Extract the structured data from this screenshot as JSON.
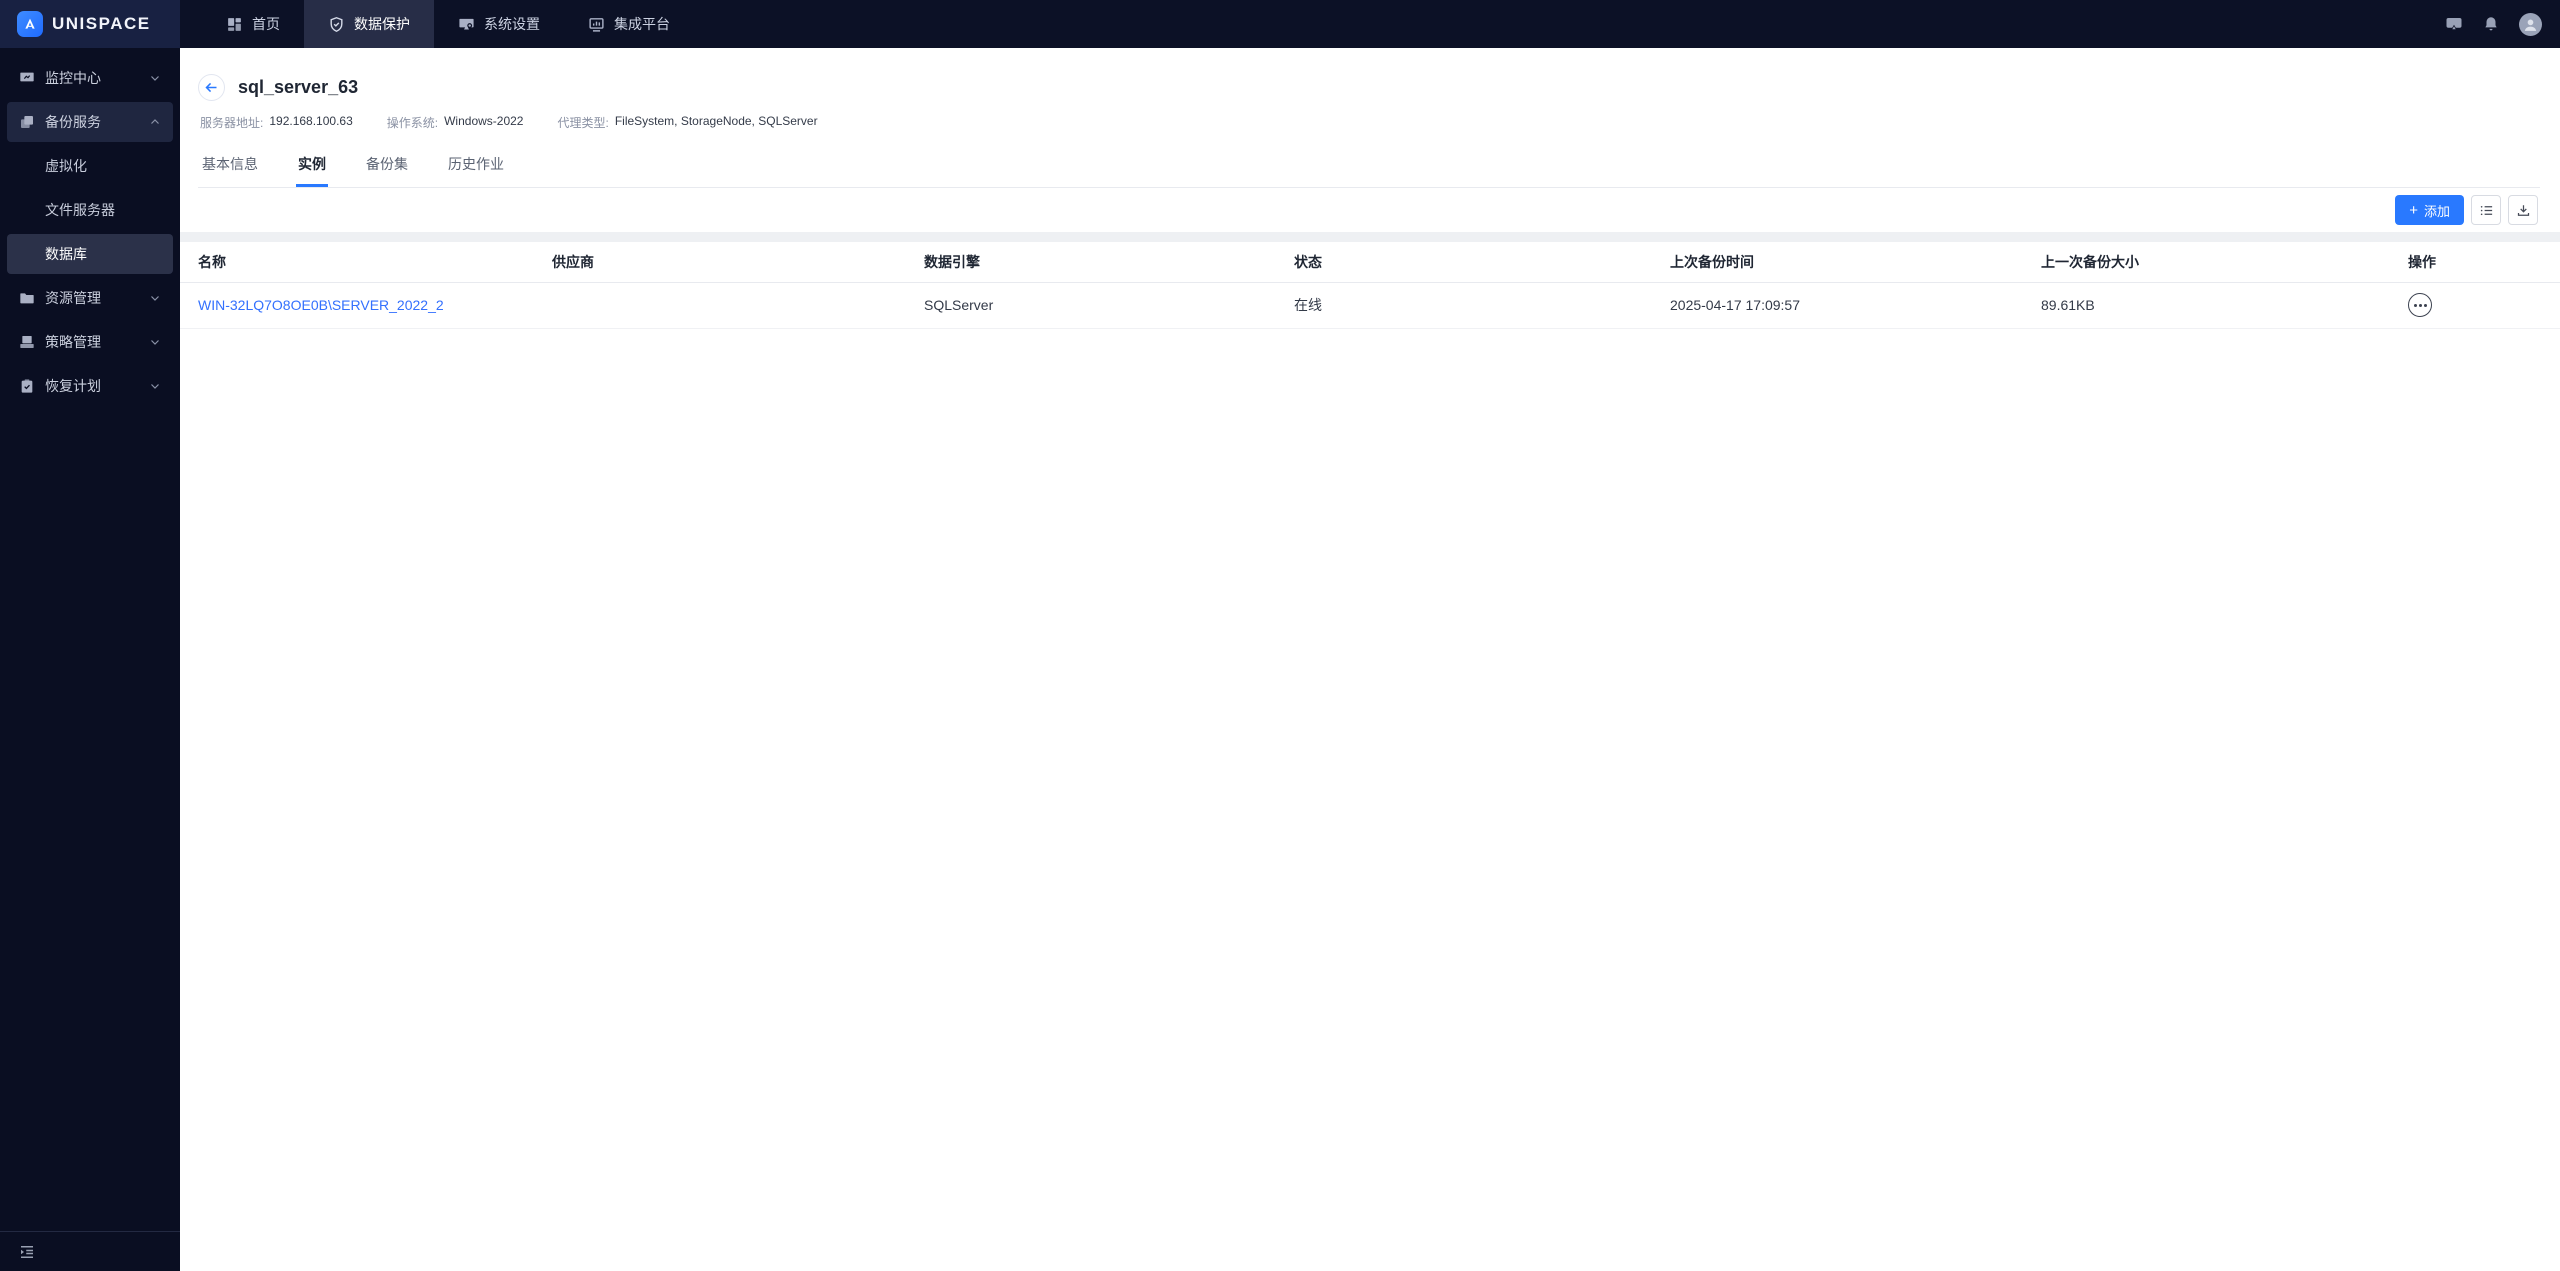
{
  "brand": {
    "name": "UNISPACE"
  },
  "topnav": {
    "items": [
      {
        "label": "首页"
      },
      {
        "label": "数据保护"
      },
      {
        "label": "系统设置"
      },
      {
        "label": "集成平台"
      }
    ]
  },
  "sidebar": {
    "items": [
      {
        "label": "监控中心",
        "state": "collapsed"
      },
      {
        "label": "备份服务",
        "state": "expanded"
      },
      {
        "label": "资源管理",
        "state": "collapsed"
      },
      {
        "label": "策略管理",
        "state": "collapsed"
      },
      {
        "label": "恢复计划",
        "state": "collapsed"
      }
    ],
    "backup_children": [
      {
        "label": "虚拟化",
        "selected": false
      },
      {
        "label": "文件服务器",
        "selected": false
      },
      {
        "label": "数据库",
        "selected": true
      }
    ]
  },
  "page": {
    "title": "sql_server_63",
    "info": [
      {
        "label": "服务器地址:",
        "value": "192.168.100.63"
      },
      {
        "label": "操作系统:",
        "value": "Windows-2022"
      },
      {
        "label": "代理类型:",
        "value": "FileSystem, StorageNode, SQLServer"
      }
    ],
    "tabs": [
      {
        "label": "基本信息",
        "active": false
      },
      {
        "label": "实例",
        "active": true
      },
      {
        "label": "备份集",
        "active": false
      },
      {
        "label": "历史作业",
        "active": false
      }
    ],
    "toolbar": {
      "add_label": "添加"
    },
    "table": {
      "headers": [
        "名称",
        "供应商",
        "数据引擎",
        "状态",
        "上次备份时间",
        "上一次备份大小",
        "操作"
      ],
      "rows": [
        {
          "name": "WIN-32LQ7O8OE0B\\SERVER_2022_2",
          "vendor": "",
          "engine": "SQLServer",
          "status": "在线",
          "last_backup_time": "2025-04-17 17:09:57",
          "last_backup_size": "89.61KB"
        }
      ]
    }
  },
  "colors": {
    "accent": "#2979ff",
    "navbar_bg": "#0c1126",
    "sidebar_bg": "#0a0e22",
    "link": "#3370fe"
  }
}
